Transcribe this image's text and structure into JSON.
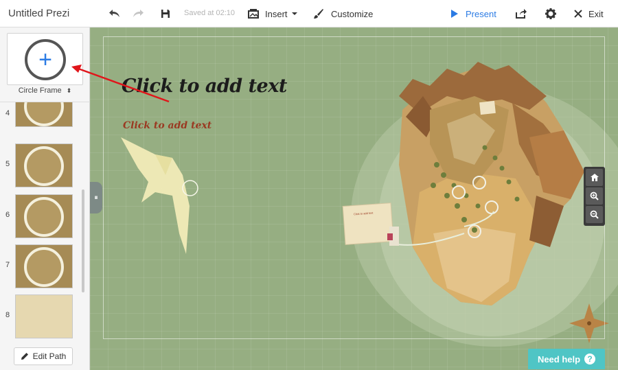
{
  "toolbar": {
    "doc_title": "Untitled Prezi",
    "saved_text": "Saved at 02:10",
    "insert_label": "Insert",
    "customize_label": "Customize",
    "present_label": "Present",
    "exit_label": "Exit",
    "accent_color": "#2b7be4"
  },
  "sidebar": {
    "frame_type": "Circle Frame",
    "thumbnails": [
      {
        "number": "4"
      },
      {
        "number": "5"
      },
      {
        "number": "6"
      },
      {
        "number": "7"
      },
      {
        "number": "8"
      }
    ],
    "edit_path_label": "Edit Path"
  },
  "canvas": {
    "title_placeholder": "Click to add text",
    "subtitle_placeholder": "Click to add text",
    "paper_note": "Click to add text"
  },
  "help": {
    "label": "Need help",
    "color": "#4fc5c5"
  }
}
